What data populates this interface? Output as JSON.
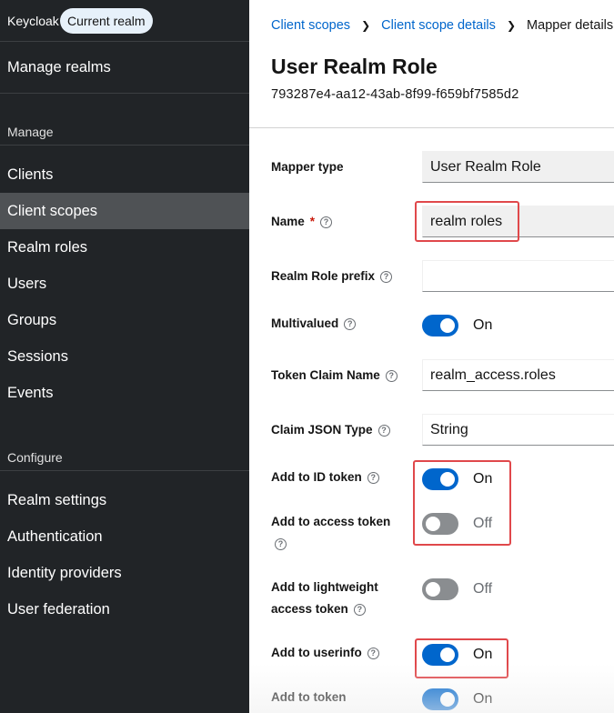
{
  "sidebar": {
    "realm_name": "Keycloak",
    "realm_badge": "Current realm",
    "manage_realms": "Manage realms",
    "section_manage": "Manage",
    "manage_items": [
      "Clients",
      "Client scopes",
      "Realm roles",
      "Users",
      "Groups",
      "Sessions",
      "Events"
    ],
    "active_item": "Client scopes",
    "section_configure": "Configure",
    "configure_items": [
      "Realm settings",
      "Authentication",
      "Identity providers",
      "User federation"
    ]
  },
  "breadcrumb": [
    "Client scopes",
    "Client scope details",
    "Mapper details"
  ],
  "page": {
    "title": "User Realm Role",
    "subtitle": "793287e4-aa12-43ab-8f99-f659bf7585d2"
  },
  "form": {
    "mapper_type": {
      "label": "Mapper type",
      "value": "User Realm Role"
    },
    "name": {
      "label": "Name",
      "value": "realm roles",
      "required_mark": "*"
    },
    "realm_role_prefix": {
      "label": "Realm Role prefix",
      "value": ""
    },
    "multivalued": {
      "label": "Multivalued",
      "state": "On"
    },
    "token_claim_name": {
      "label": "Token Claim Name",
      "value": "realm_access.roles"
    },
    "claim_json_type": {
      "label": "Claim JSON Type",
      "value": "String"
    },
    "add_to_id_token": {
      "label": "Add to ID token",
      "state": "On"
    },
    "add_to_access_token": {
      "label_line1": "Add to access token",
      "state": "Off"
    },
    "add_to_lightweight": {
      "label_line1": "Add to lightweight",
      "label_line2": "access token",
      "state": "Off"
    },
    "add_to_userinfo": {
      "label": "Add to userinfo",
      "state": "On"
    },
    "add_to_token_introspection": {
      "label": "Add to token",
      "state": "On"
    }
  },
  "colors": {
    "sidebar_bg": "#212427",
    "active_nav_bg": "#4f5255",
    "accent": "#0066cc",
    "highlight": "#e0484b"
  }
}
